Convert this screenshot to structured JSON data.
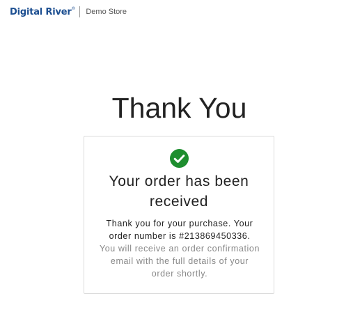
{
  "header": {
    "brand": "Digital River",
    "trademark": "®",
    "store_name": "Demo Store"
  },
  "page": {
    "title": "Thank You"
  },
  "confirmation": {
    "heading_line1": "Your order has been",
    "heading_line2": "received",
    "thank_you_line1": "Thank you for your purchase. Your",
    "thank_you_line2": "order number is #213869450336.",
    "email_line1": "You will receive an order confirmation",
    "email_line2": "email with the full details of your",
    "email_line3": "order shortly.",
    "success_color": "#1e8e2f",
    "icon": "checkmark-circle-icon"
  }
}
